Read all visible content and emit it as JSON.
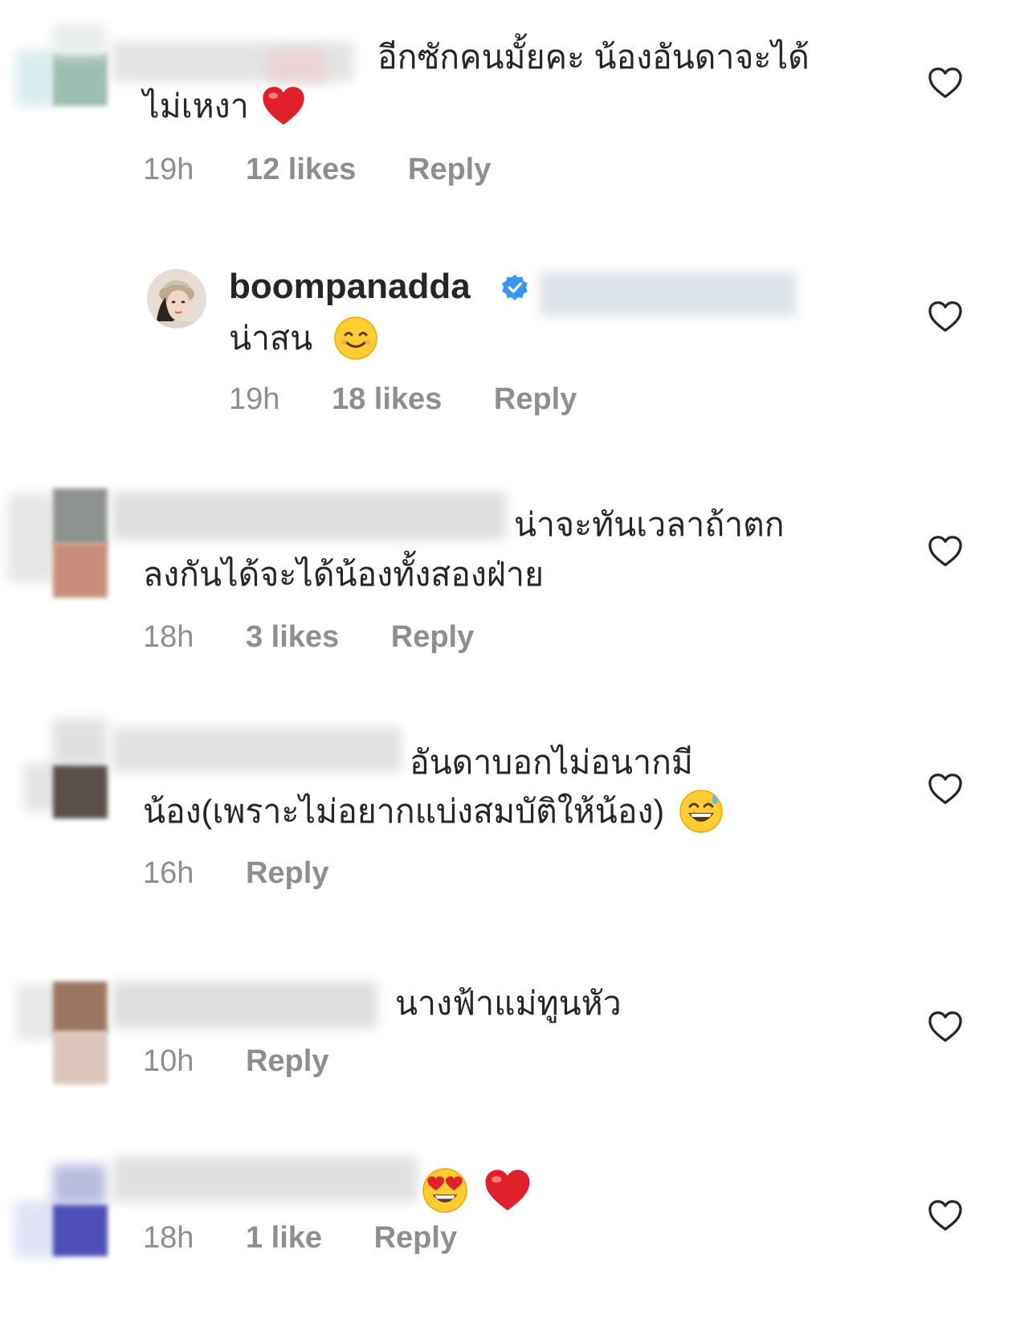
{
  "comments": [
    {
      "text_line1": "อีกซักคนมั้ยคะ  น้องอันดาจะได้",
      "text_line2": "ไม่เหงา",
      "time": "19h",
      "likes": "12 likes",
      "reply": "Reply"
    },
    {
      "username": "boompanadda",
      "verified": true,
      "text_line1": "น่าสน",
      "time": "19h",
      "likes": "18 likes",
      "reply": "Reply"
    },
    {
      "text_line1": "น่าจะทันเวลาถ้าตก",
      "text_line2": "ลงกันได้จะได้น้องทั้งสองฝ่าย",
      "time": "18h",
      "likes": "3 likes",
      "reply": "Reply"
    },
    {
      "text_line1": "อันดาบอกไม่อนากมี",
      "text_line2": "น้อง(เพราะไม่อยากแบ่งสมบัติให้น้อง)",
      "time": "16h",
      "reply": "Reply"
    },
    {
      "text_line1": "นางฟ้าแม่ทูนหัว",
      "time": "10h",
      "reply": "Reply"
    },
    {
      "time": "18h",
      "likes": "1 like",
      "reply": "Reply"
    }
  ],
  "icons": {
    "like": "heart-outline-icon",
    "verified": "verified-badge-icon",
    "emoji_heart": "red-heart-emoji",
    "emoji_smile": "smiling-face-emoji",
    "emoji_sweat": "grinning-sweat-emoji",
    "emoji_hearteyes": "heart-eyes-emoji"
  },
  "colors": {
    "text": "#262626",
    "meta": "#8e8e8e",
    "verified": "#3897f0",
    "heart_emoji": "#e0202a"
  }
}
